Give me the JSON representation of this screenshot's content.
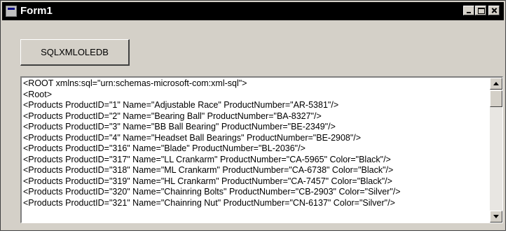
{
  "window": {
    "title": "Form1"
  },
  "button": {
    "label": "SQLXMLOLEDB"
  },
  "output": {
    "lines": [
      "<ROOT xmlns:sql=\"urn:schemas-microsoft-com:xml-sql\">",
      "<Root>",
      "<Products ProductID=\"1\" Name=\"Adjustable Race\" ProductNumber=\"AR-5381\"/>",
      "<Products ProductID=\"2\" Name=\"Bearing Ball\" ProductNumber=\"BA-8327\"/>",
      "<Products ProductID=\"3\" Name=\"BB Ball Bearing\" ProductNumber=\"BE-2349\"/>",
      "<Products ProductID=\"4\" Name=\"Headset Ball Bearings\" ProductNumber=\"BE-2908\"/>",
      "<Products ProductID=\"316\" Name=\"Blade\" ProductNumber=\"BL-2036\"/>",
      "<Products ProductID=\"317\" Name=\"LL Crankarm\" ProductNumber=\"CA-5965\" Color=\"Black\"/>",
      "<Products ProductID=\"318\" Name=\"ML Crankarm\" ProductNumber=\"CA-6738\" Color=\"Black\"/>",
      "<Products ProductID=\"319\" Name=\"HL Crankarm\" ProductNumber=\"CA-7457\" Color=\"Black\"/>",
      "<Products ProductID=\"320\" Name=\"Chainring Bolts\" ProductNumber=\"CB-2903\" Color=\"Silver\"/>",
      "<Products ProductID=\"321\" Name=\"Chainring Nut\" ProductNumber=\"CN-6137\" Color=\"Silver\"/>"
    ]
  },
  "icons": {
    "app": "form-icon",
    "minimize": "minimize-icon",
    "maximize": "maximize-icon",
    "close": "close-icon",
    "scroll_up": "scroll-up-icon",
    "scroll_down": "scroll-down-icon"
  },
  "colors": {
    "title_bar": "#000000",
    "title_text": "#ffffff",
    "face": "#d4d0c8",
    "output_background": "#ffffff"
  }
}
